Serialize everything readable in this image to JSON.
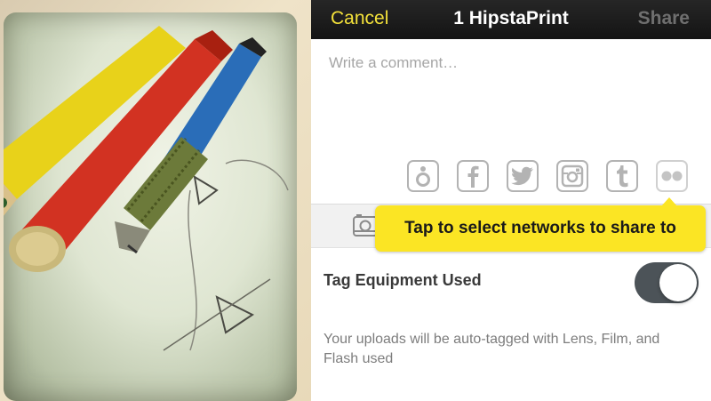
{
  "navbar": {
    "cancel_label": "Cancel",
    "title": "1 HipstaPrint",
    "share_label": "Share"
  },
  "comment": {
    "placeholder": "Write a comment…",
    "value": ""
  },
  "networks": [
    {
      "name": "foursquare",
      "icon": "foursquare-icon"
    },
    {
      "name": "facebook",
      "icon": "facebook-icon"
    },
    {
      "name": "twitter",
      "icon": "twitter-icon"
    },
    {
      "name": "instagram",
      "icon": "instagram-icon"
    },
    {
      "name": "tumblr",
      "icon": "tumblr-icon"
    },
    {
      "name": "flickr",
      "icon": "flickr-icon"
    }
  ],
  "tooltip": {
    "text": "Tap to select networks to share to"
  },
  "tag_equipment": {
    "label": "Tag Equipment Used",
    "enabled": true,
    "description": "Your uploads will be auto-tagged with Lens, Film, and Flash used"
  },
  "colors": {
    "accent_yellow": "#f3e13a",
    "tooltip_yellow": "#fbe524",
    "navbar_bg": "#1c1c1c",
    "toggle_on": "#4c5358"
  }
}
